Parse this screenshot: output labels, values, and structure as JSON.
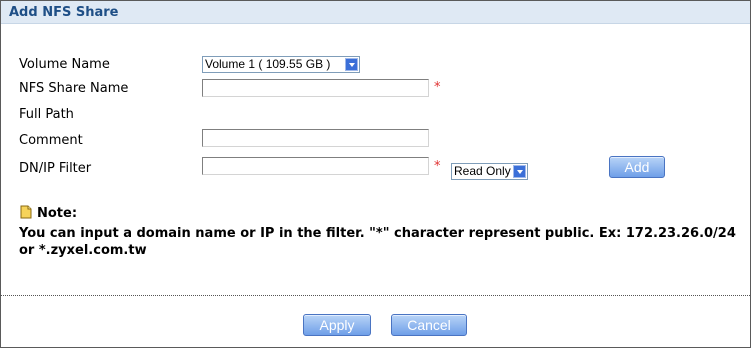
{
  "panel": {
    "title": "Add NFS Share"
  },
  "form": {
    "volume_name_label": "Volume Name",
    "volume_name_value": "Volume 1 ( 109.55 GB )",
    "nfs_share_name_label": "NFS Share Name",
    "nfs_share_name_value": "",
    "full_path_label": "Full Path",
    "comment_label": "Comment",
    "comment_value": "",
    "dn_ip_filter_label": "DN/IP Filter",
    "dn_ip_filter_value": "",
    "access_value": "Read Only",
    "required_mark": "*",
    "add_button": "Add"
  },
  "note": {
    "heading": "Note:",
    "text": "You can input a domain name or IP in the filter. \"*\" character represent public. Ex: 172.23.26.0/24 or *.zyxel.com.tw"
  },
  "actions": {
    "apply": "Apply",
    "cancel": "Cancel"
  },
  "colors": {
    "title_bg": "#dfe9f4",
    "title_text": "#1f4f86",
    "button": "#6f9fe8",
    "required": "#e03030"
  },
  "icons": {
    "note": "note-icon",
    "dropdown": "chevron-down-icon"
  }
}
